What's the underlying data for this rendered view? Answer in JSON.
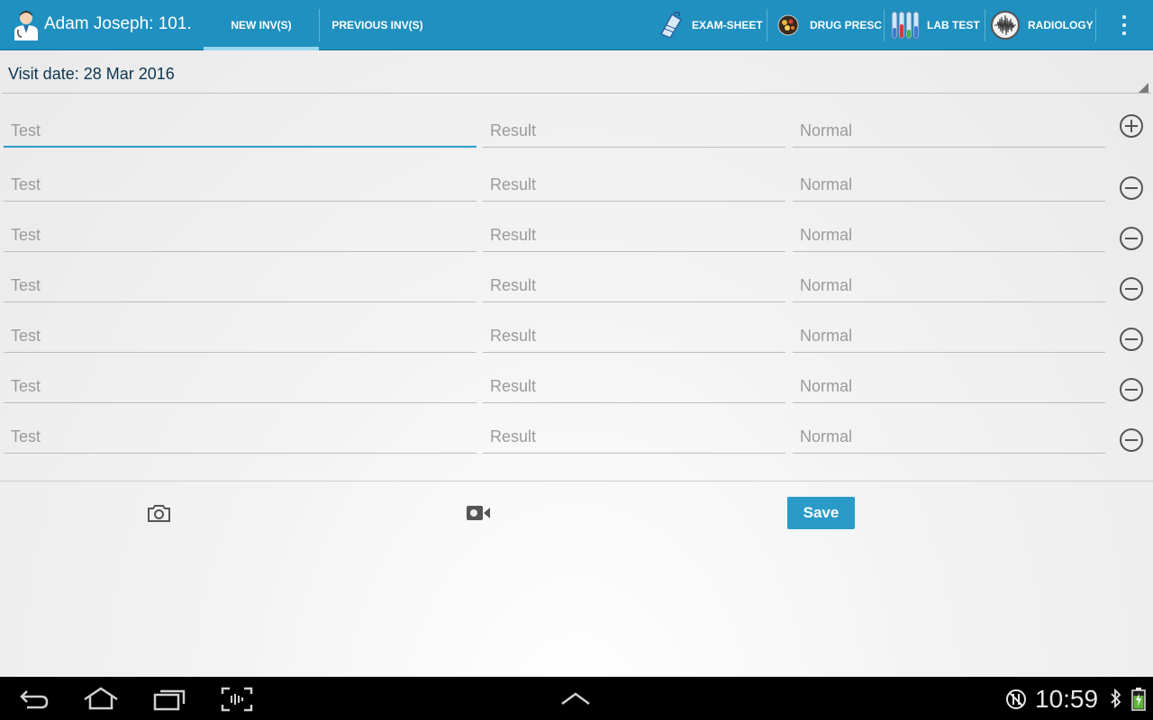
{
  "header": {
    "patient_name": "Adam Joseph: 101.",
    "tabs": [
      {
        "label": "NEW INV(S)",
        "active": true
      },
      {
        "label": "PREVIOUS INV(S)",
        "active": false
      }
    ],
    "actions": [
      {
        "label": "EXAM-SHEET",
        "icon": "clipboard-pen-icon"
      },
      {
        "label": "DRUG PRESC",
        "icon": "pills-icon"
      },
      {
        "label": "LAB TEST",
        "icon": "test-tubes-icon"
      },
      {
        "label": "RADIOLOGY",
        "icon": "waveform-icon"
      }
    ]
  },
  "visit": {
    "label": "Visit date: 28 Mar 2016"
  },
  "placeholders": {
    "test": "Test",
    "result": "Result",
    "normal": "Normal"
  },
  "rows": [
    {
      "test": "",
      "result": "",
      "normal": "",
      "control": "add-row"
    },
    {
      "test": "",
      "result": "",
      "normal": "",
      "control": "remove-row"
    },
    {
      "test": "",
      "result": "",
      "normal": "",
      "control": "remove-row"
    },
    {
      "test": "",
      "result": "",
      "normal": "",
      "control": "remove-row"
    },
    {
      "test": "",
      "result": "",
      "normal": "",
      "control": "remove-row"
    },
    {
      "test": "",
      "result": "",
      "normal": "",
      "control": "remove-row"
    },
    {
      "test": "",
      "result": "",
      "normal": "",
      "control": "remove-row"
    }
  ],
  "footer": {
    "save_label": "Save",
    "photo_icon": "camera-icon",
    "video_icon": "video-camera-icon"
  },
  "system_bar": {
    "time": "10:59"
  },
  "colors": {
    "action_bar": "#1f90bf",
    "accent": "#2b9bd0",
    "save_button": "#2a9ac9"
  }
}
